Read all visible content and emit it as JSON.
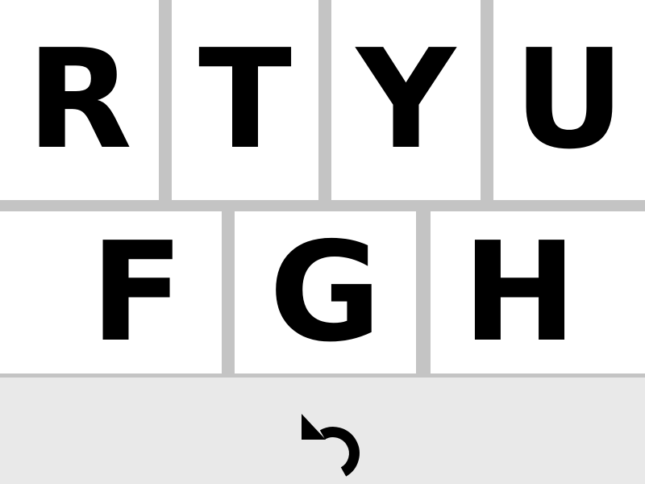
{
  "keyboard": {
    "rows": [
      {
        "keys": [
          "R",
          "T",
          "Y",
          "U"
        ]
      },
      {
        "keys": [
          "F",
          "G",
          "H"
        ]
      }
    ]
  },
  "bottom_bar": {
    "undo_icon": "undo-icon"
  },
  "colors": {
    "background_gap": "#c4c4c4",
    "key_face": "#ffffff",
    "key_text": "#000000",
    "bottom_bar": "#e9e9e9"
  }
}
